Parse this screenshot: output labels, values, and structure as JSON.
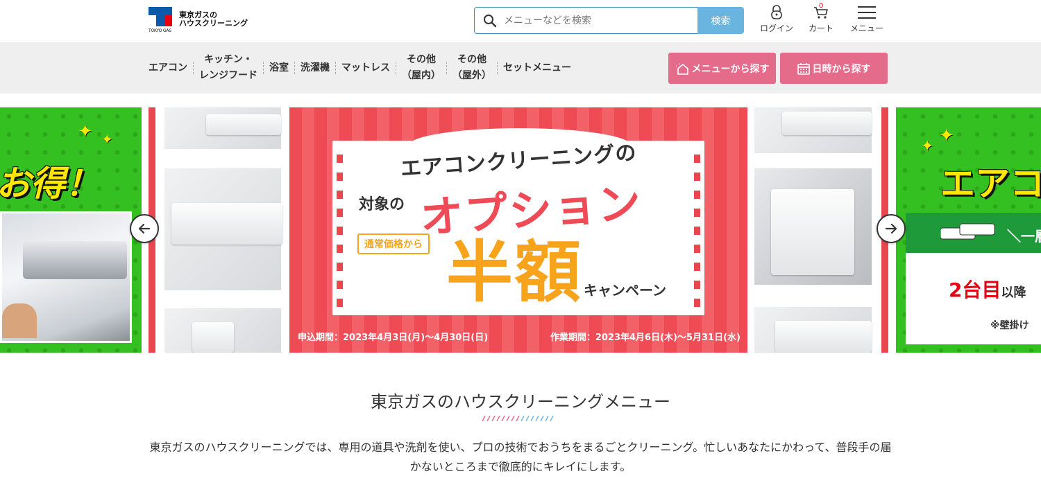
{
  "header": {
    "logo_text_line1": "東京ガスの",
    "logo_text_line2": "ハウスクリーニング",
    "logo_small": "TOKYO GAS",
    "search_placeholder": "メニューなどを検索",
    "search_button": "検索",
    "login_label": "ログイン",
    "cart_label": "カート",
    "cart_count": "0",
    "menu_label": "メニュー"
  },
  "nav": {
    "items": [
      {
        "line1": "エアコン",
        "line2": ""
      },
      {
        "line1": "キッチン・",
        "line2": "レンジフード"
      },
      {
        "line1": "浴室",
        "line2": ""
      },
      {
        "line1": "洗濯機",
        "line2": ""
      },
      {
        "line1": "マットレス",
        "line2": ""
      },
      {
        "line1": "その他",
        "line2": "（屋内）"
      },
      {
        "line1": "その他",
        "line2": "（屋外）"
      },
      {
        "line1": "セットメニュー",
        "line2": ""
      }
    ],
    "btn_menu_search": "メニューから探す",
    "btn_date_search": "日時から探す"
  },
  "carousel": {
    "left_slide_text": "お得！",
    "banner": {
      "title": "エアコンクリーニングの",
      "taisho": "対象の",
      "option": "オプション",
      "tsujo": "通常価格から",
      "hangaku": "半額",
      "campaign": "キャンペーン",
      "period_apply": "申込期間：2023年4月3日(月)～4月30日(日)",
      "period_work": "作業期間：2023年4月6日(木)～5月31日(水)"
    },
    "right_slide": {
      "aircon": "エアコ",
      "ichi": "＼一層",
      "second": "2台目",
      "second_suffix": "以降",
      "wall": "※壁掛け"
    }
  },
  "section": {
    "title": "東京ガスのハウスクリーニングメニュー",
    "description": "東京ガスのハウスクリーニングでは、専用の道具や洗剤を使い、プロの技術でおうちをまるごとクリーニング。忙しいあなたにかわって、普段手の届かないところまで徹底的にキレイにします。"
  },
  "colors": {
    "pink_button": "#e56b8a",
    "search_button": "#6ab5e0",
    "banner_red": "#ee4b54",
    "banner_orange": "#f7a41c",
    "green": "#35c021"
  }
}
